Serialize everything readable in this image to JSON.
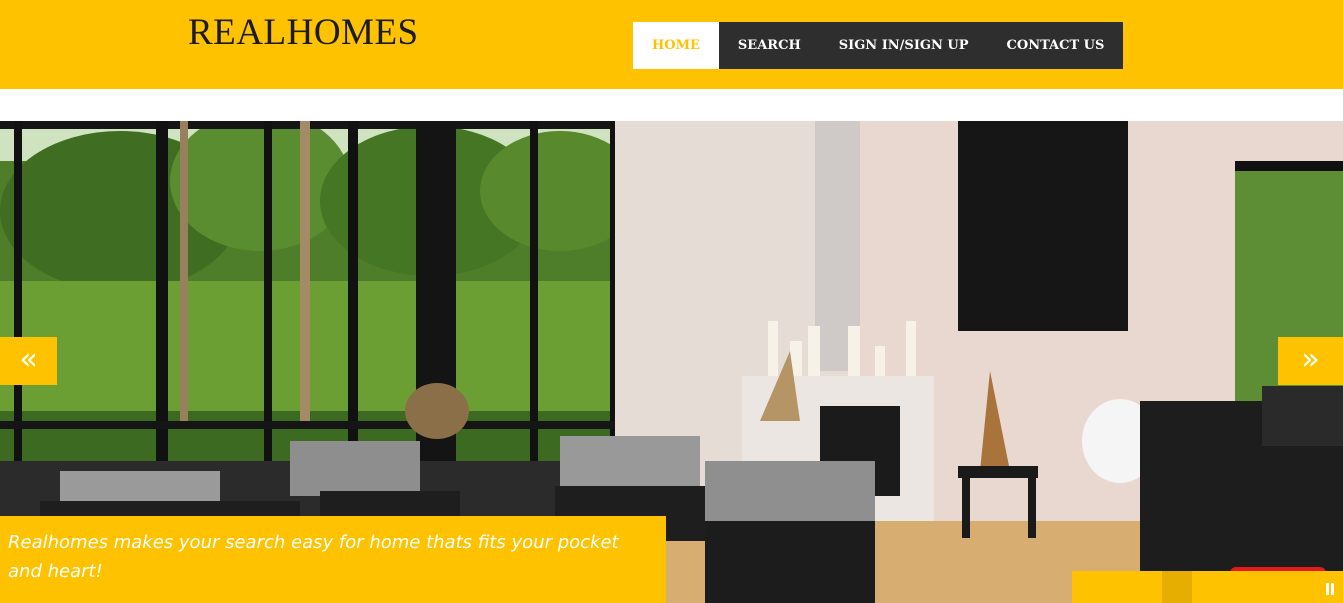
{
  "header": {
    "logo": "REALHOMES",
    "nav": [
      {
        "label": "HOME",
        "active": true
      },
      {
        "label": "SEARCH",
        "active": false
      },
      {
        "label": "SIGN IN/SIGN UP",
        "active": false
      },
      {
        "label": "CONTACT US",
        "active": false
      }
    ]
  },
  "slider": {
    "prev_icon": "«",
    "next_icon": "»",
    "caption": "Realhomes makes your search easy for home thats fits your pocket and heart!",
    "controls": {
      "pause_icon": "pause-icon"
    }
  },
  "colors": {
    "accent": "#ffc200",
    "nav_bg": "#2e2e2e",
    "text_dark": "#1b1b1b"
  }
}
